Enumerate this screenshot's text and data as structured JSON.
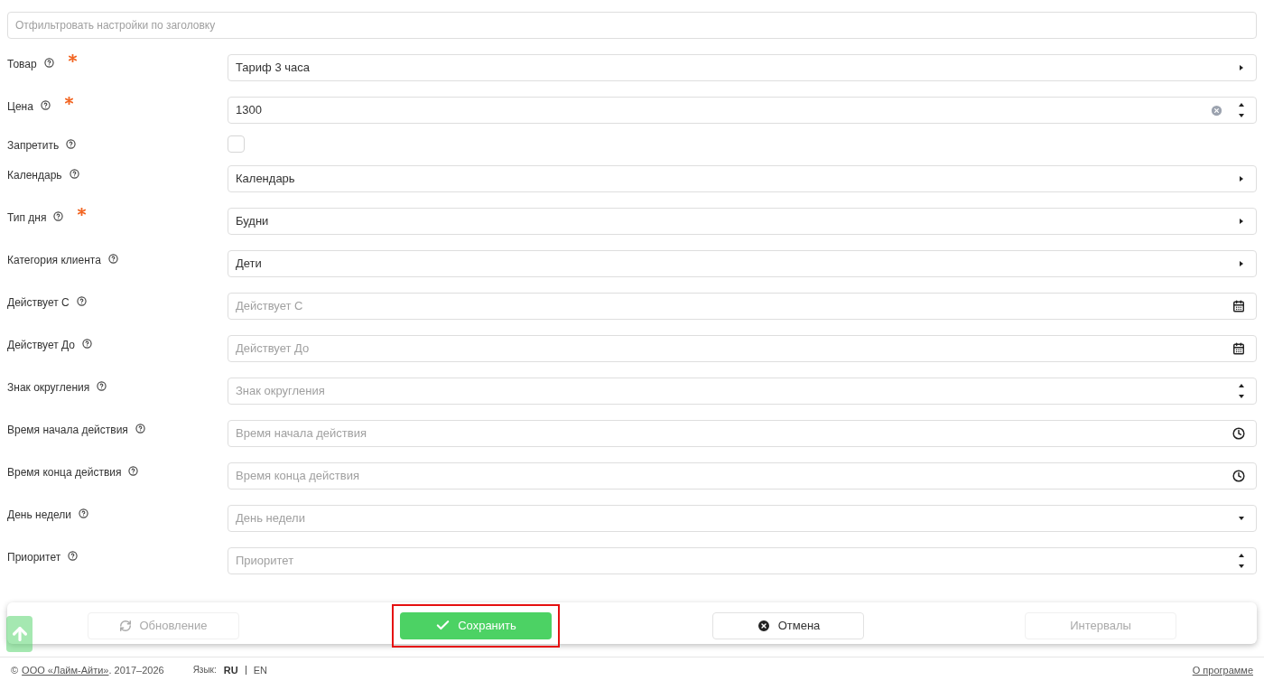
{
  "filter": {
    "placeholder": "Отфильтровать настройки по заголовку"
  },
  "fields": [
    {
      "label": "Товар",
      "required": true,
      "kind": "select",
      "value": "Тариф 3 часа"
    },
    {
      "label": "Цена",
      "required": true,
      "kind": "number",
      "value": "1300"
    },
    {
      "label": "Запретить",
      "required": false,
      "kind": "checkbox",
      "checked": false
    },
    {
      "label": "Календарь",
      "required": false,
      "kind": "select",
      "value": "Календарь"
    },
    {
      "label": "Тип дня",
      "required": true,
      "kind": "select",
      "value": "Будни"
    },
    {
      "label": "Категория клиента",
      "required": false,
      "kind": "select",
      "value": "Дети"
    },
    {
      "label": "Действует С",
      "required": false,
      "kind": "date",
      "placeholder": "Действует С"
    },
    {
      "label": "Действует До",
      "required": false,
      "kind": "date",
      "placeholder": "Действует До"
    },
    {
      "label": "Знак округления",
      "required": false,
      "kind": "number",
      "placeholder": "Знак округления"
    },
    {
      "label": "Время начала действия",
      "required": false,
      "kind": "time",
      "placeholder": "Время начала действия"
    },
    {
      "label": "Время конца действия",
      "required": false,
      "kind": "time",
      "placeholder": "Время конца действия"
    },
    {
      "label": "День недели",
      "required": false,
      "kind": "dropdown",
      "placeholder": "День недели"
    },
    {
      "label": "Приоритет",
      "required": false,
      "kind": "number",
      "placeholder": "Приоритет"
    }
  ],
  "actions": [
    {
      "label": "Обновление",
      "kind": "refresh",
      "disabled": true,
      "highlighted": false
    },
    {
      "label": "Сохранить",
      "kind": "save",
      "disabled": false,
      "highlighted": true
    },
    {
      "label": "Отмена",
      "kind": "cancel",
      "disabled": false,
      "highlighted": false
    },
    {
      "label": "Интервалы",
      "kind": "plain",
      "disabled": true,
      "highlighted": false
    }
  ],
  "footer": {
    "copyright": "©",
    "company": "ООО «Лайм-Айти»",
    "years": ". 2017–2026",
    "language_label": "Язык:",
    "languages": [
      {
        "label": "RU",
        "selected": true
      },
      {
        "label": "EN",
        "selected": false
      }
    ],
    "about": "О программе"
  }
}
